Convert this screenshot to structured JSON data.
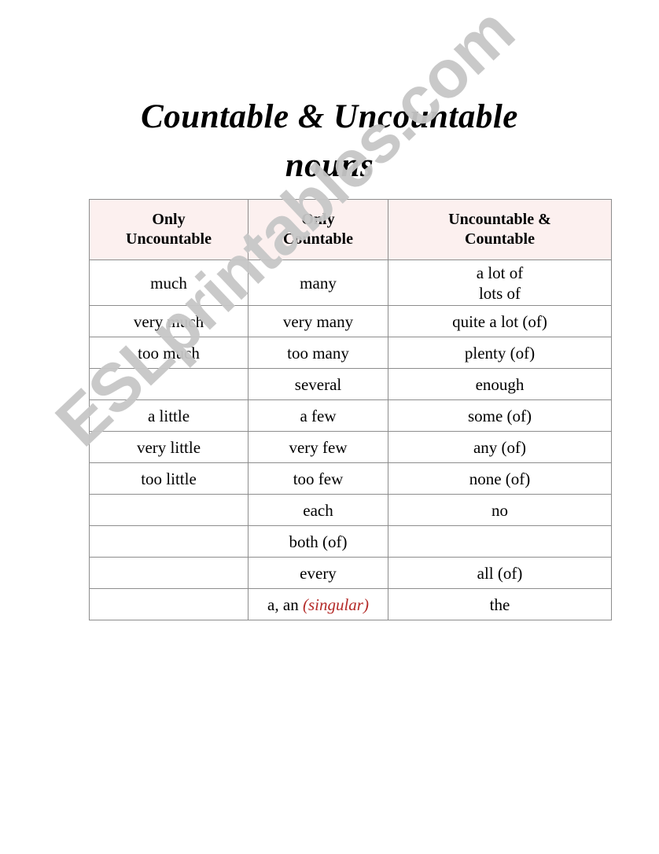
{
  "document": {
    "title_lines": [
      "Countable & Uncountable",
      "nouns"
    ],
    "watermark": "ESLprintables.com",
    "colors": {
      "header_background": "#fcf0ef",
      "grid_border": "#8d8d8d",
      "text": "#000000",
      "note_red": "#b42a28",
      "watermark_gray": "#c7c7c7",
      "page_background": "#ffffff"
    }
  },
  "table": {
    "headers": [
      {
        "line1": "Only",
        "line2": "Uncountable"
      },
      {
        "line1": "Only",
        "line2": "Countable"
      },
      {
        "line1": "Uncountable &",
        "line2": "Countable"
      }
    ],
    "rows": [
      {
        "col1": "much",
        "col2": "many",
        "col3_line1": "a lot of",
        "col3_line2": "lots of"
      },
      {
        "col1": "very much",
        "col2": "very many",
        "col3": "quite a lot (of)"
      },
      {
        "col1": "too much",
        "col2": "too many",
        "col3": "plenty (of)"
      },
      {
        "col1": "",
        "col2": "several",
        "col3": "enough"
      },
      {
        "col1": "a little",
        "col2": "a few",
        "col3": "some (of)"
      },
      {
        "col1": "very little",
        "col2": "very few",
        "col3": "any (of)"
      },
      {
        "col1": "too little",
        "col2": "too few",
        "col3": "none (of)"
      },
      {
        "col1": "",
        "col2": "each",
        "col3": "no"
      },
      {
        "col1": "",
        "col2": "both (of)",
        "col3": ""
      },
      {
        "col1": "",
        "col2": "every",
        "col3": "all (of)"
      },
      {
        "col1": "",
        "col2": "a, an",
        "col2_note": "(singular)",
        "col3": "the"
      }
    ]
  }
}
